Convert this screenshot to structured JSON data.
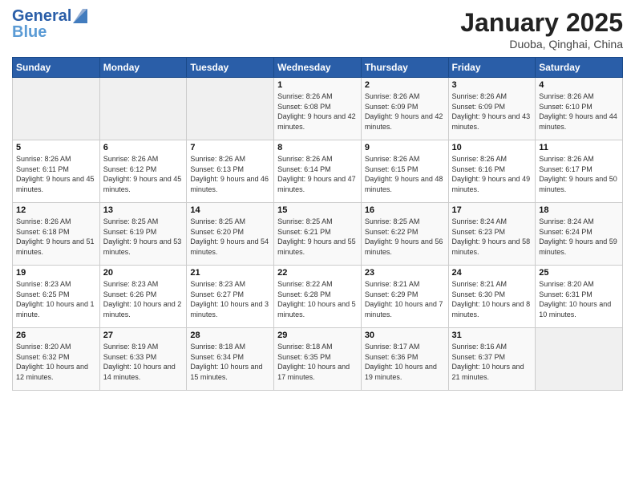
{
  "logo": {
    "line1": "General",
    "line2": "Blue"
  },
  "title": "January 2025",
  "subtitle": "Duoba, Qinghai, China",
  "weekdays": [
    "Sunday",
    "Monday",
    "Tuesday",
    "Wednesday",
    "Thursday",
    "Friday",
    "Saturday"
  ],
  "weeks": [
    [
      {
        "day": "",
        "sunrise": "",
        "sunset": "",
        "daylight": ""
      },
      {
        "day": "",
        "sunrise": "",
        "sunset": "",
        "daylight": ""
      },
      {
        "day": "",
        "sunrise": "",
        "sunset": "",
        "daylight": ""
      },
      {
        "day": "1",
        "sunrise": "Sunrise: 8:26 AM",
        "sunset": "Sunset: 6:08 PM",
        "daylight": "Daylight: 9 hours and 42 minutes."
      },
      {
        "day": "2",
        "sunrise": "Sunrise: 8:26 AM",
        "sunset": "Sunset: 6:09 PM",
        "daylight": "Daylight: 9 hours and 42 minutes."
      },
      {
        "day": "3",
        "sunrise": "Sunrise: 8:26 AM",
        "sunset": "Sunset: 6:09 PM",
        "daylight": "Daylight: 9 hours and 43 minutes."
      },
      {
        "day": "4",
        "sunrise": "Sunrise: 8:26 AM",
        "sunset": "Sunset: 6:10 PM",
        "daylight": "Daylight: 9 hours and 44 minutes."
      }
    ],
    [
      {
        "day": "5",
        "sunrise": "Sunrise: 8:26 AM",
        "sunset": "Sunset: 6:11 PM",
        "daylight": "Daylight: 9 hours and 45 minutes."
      },
      {
        "day": "6",
        "sunrise": "Sunrise: 8:26 AM",
        "sunset": "Sunset: 6:12 PM",
        "daylight": "Daylight: 9 hours and 45 minutes."
      },
      {
        "day": "7",
        "sunrise": "Sunrise: 8:26 AM",
        "sunset": "Sunset: 6:13 PM",
        "daylight": "Daylight: 9 hours and 46 minutes."
      },
      {
        "day": "8",
        "sunrise": "Sunrise: 8:26 AM",
        "sunset": "Sunset: 6:14 PM",
        "daylight": "Daylight: 9 hours and 47 minutes."
      },
      {
        "day": "9",
        "sunrise": "Sunrise: 8:26 AM",
        "sunset": "Sunset: 6:15 PM",
        "daylight": "Daylight: 9 hours and 48 minutes."
      },
      {
        "day": "10",
        "sunrise": "Sunrise: 8:26 AM",
        "sunset": "Sunset: 6:16 PM",
        "daylight": "Daylight: 9 hours and 49 minutes."
      },
      {
        "day": "11",
        "sunrise": "Sunrise: 8:26 AM",
        "sunset": "Sunset: 6:17 PM",
        "daylight": "Daylight: 9 hours and 50 minutes."
      }
    ],
    [
      {
        "day": "12",
        "sunrise": "Sunrise: 8:26 AM",
        "sunset": "Sunset: 6:18 PM",
        "daylight": "Daylight: 9 hours and 51 minutes."
      },
      {
        "day": "13",
        "sunrise": "Sunrise: 8:25 AM",
        "sunset": "Sunset: 6:19 PM",
        "daylight": "Daylight: 9 hours and 53 minutes."
      },
      {
        "day": "14",
        "sunrise": "Sunrise: 8:25 AM",
        "sunset": "Sunset: 6:20 PM",
        "daylight": "Daylight: 9 hours and 54 minutes."
      },
      {
        "day": "15",
        "sunrise": "Sunrise: 8:25 AM",
        "sunset": "Sunset: 6:21 PM",
        "daylight": "Daylight: 9 hours and 55 minutes."
      },
      {
        "day": "16",
        "sunrise": "Sunrise: 8:25 AM",
        "sunset": "Sunset: 6:22 PM",
        "daylight": "Daylight: 9 hours and 56 minutes."
      },
      {
        "day": "17",
        "sunrise": "Sunrise: 8:24 AM",
        "sunset": "Sunset: 6:23 PM",
        "daylight": "Daylight: 9 hours and 58 minutes."
      },
      {
        "day": "18",
        "sunrise": "Sunrise: 8:24 AM",
        "sunset": "Sunset: 6:24 PM",
        "daylight": "Daylight: 9 hours and 59 minutes."
      }
    ],
    [
      {
        "day": "19",
        "sunrise": "Sunrise: 8:23 AM",
        "sunset": "Sunset: 6:25 PM",
        "daylight": "Daylight: 10 hours and 1 minute."
      },
      {
        "day": "20",
        "sunrise": "Sunrise: 8:23 AM",
        "sunset": "Sunset: 6:26 PM",
        "daylight": "Daylight: 10 hours and 2 minutes."
      },
      {
        "day": "21",
        "sunrise": "Sunrise: 8:23 AM",
        "sunset": "Sunset: 6:27 PM",
        "daylight": "Daylight: 10 hours and 3 minutes."
      },
      {
        "day": "22",
        "sunrise": "Sunrise: 8:22 AM",
        "sunset": "Sunset: 6:28 PM",
        "daylight": "Daylight: 10 hours and 5 minutes."
      },
      {
        "day": "23",
        "sunrise": "Sunrise: 8:21 AM",
        "sunset": "Sunset: 6:29 PM",
        "daylight": "Daylight: 10 hours and 7 minutes."
      },
      {
        "day": "24",
        "sunrise": "Sunrise: 8:21 AM",
        "sunset": "Sunset: 6:30 PM",
        "daylight": "Daylight: 10 hours and 8 minutes."
      },
      {
        "day": "25",
        "sunrise": "Sunrise: 8:20 AM",
        "sunset": "Sunset: 6:31 PM",
        "daylight": "Daylight: 10 hours and 10 minutes."
      }
    ],
    [
      {
        "day": "26",
        "sunrise": "Sunrise: 8:20 AM",
        "sunset": "Sunset: 6:32 PM",
        "daylight": "Daylight: 10 hours and 12 minutes."
      },
      {
        "day": "27",
        "sunrise": "Sunrise: 8:19 AM",
        "sunset": "Sunset: 6:33 PM",
        "daylight": "Daylight: 10 hours and 14 minutes."
      },
      {
        "day": "28",
        "sunrise": "Sunrise: 8:18 AM",
        "sunset": "Sunset: 6:34 PM",
        "daylight": "Daylight: 10 hours and 15 minutes."
      },
      {
        "day": "29",
        "sunrise": "Sunrise: 8:18 AM",
        "sunset": "Sunset: 6:35 PM",
        "daylight": "Daylight: 10 hours and 17 minutes."
      },
      {
        "day": "30",
        "sunrise": "Sunrise: 8:17 AM",
        "sunset": "Sunset: 6:36 PM",
        "daylight": "Daylight: 10 hours and 19 minutes."
      },
      {
        "day": "31",
        "sunrise": "Sunrise: 8:16 AM",
        "sunset": "Sunset: 6:37 PM",
        "daylight": "Daylight: 10 hours and 21 minutes."
      },
      {
        "day": "",
        "sunrise": "",
        "sunset": "",
        "daylight": ""
      }
    ]
  ]
}
